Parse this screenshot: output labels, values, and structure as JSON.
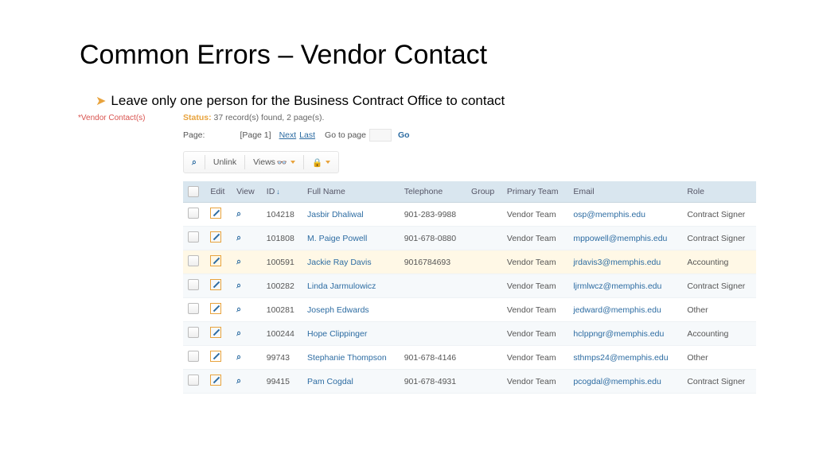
{
  "title": "Common Errors – Vendor Contact",
  "bullet": "Leave only one person for the Business Contract Office to contact",
  "section_label": "*Vendor Contact(s)",
  "status": {
    "label": "Status:",
    "text": "37 record(s) found, 2 page(s)."
  },
  "paging": {
    "label": "Page:",
    "current": "[Page 1]",
    "next": "Next",
    "last": "Last",
    "goto_label": "Go to page",
    "go": "Go"
  },
  "toolbar": {
    "unlink": "Unlink",
    "views": "Views"
  },
  "headers": {
    "edit": "Edit",
    "view": "View",
    "id": "ID",
    "full_name": "Full Name",
    "telephone": "Telephone",
    "group": "Group",
    "primary_team": "Primary Team",
    "email": "Email",
    "role": "Role"
  },
  "rows": [
    {
      "id": "104218",
      "name": "Jasbir Dhaliwal",
      "tel": "901-283-9988",
      "group": "",
      "team": "Vendor Team",
      "email": "osp@memphis.edu",
      "role": "Contract Signer",
      "hl": false
    },
    {
      "id": "101808",
      "name": "M. Paige Powell",
      "tel": "901-678-0880",
      "group": "",
      "team": "Vendor Team",
      "email": "mppowell@memphis.edu",
      "role": "Contract Signer",
      "hl": false
    },
    {
      "id": "100591",
      "name": "Jackie Ray Davis",
      "tel": "9016784693",
      "group": "",
      "team": "Vendor Team",
      "email": "jrdavis3@memphis.edu",
      "role": "Accounting",
      "hl": true
    },
    {
      "id": "100282",
      "name": "Linda Jarmulowicz",
      "tel": "",
      "group": "",
      "team": "Vendor Team",
      "email": "ljrmlwcz@memphis.edu",
      "role": "Contract Signer",
      "hl": false
    },
    {
      "id": "100281",
      "name": "Joseph Edwards",
      "tel": "",
      "group": "",
      "team": "Vendor Team",
      "email": "jedward@memphis.edu",
      "role": "Other",
      "hl": false
    },
    {
      "id": "100244",
      "name": "Hope Clippinger",
      "tel": "",
      "group": "",
      "team": "Vendor Team",
      "email": "hclppngr@memphis.edu",
      "role": "Accounting",
      "hl": false
    },
    {
      "id": "99743",
      "name": "Stephanie Thompson",
      "tel": "901-678-4146",
      "group": "",
      "team": "Vendor Team",
      "email": "sthmps24@memphis.edu",
      "role": "Other",
      "hl": false
    },
    {
      "id": "99415",
      "name": "Pam Cogdal",
      "tel": "901-678-4931",
      "group": "",
      "team": "Vendor Team",
      "email": "pcogdal@memphis.edu",
      "role": "Contract Signer",
      "hl": false
    }
  ]
}
